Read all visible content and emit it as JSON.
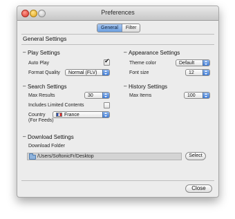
{
  "window": {
    "title": "Preferences"
  },
  "tabs": [
    {
      "label": "General",
      "active": true
    },
    {
      "label": "Filter",
      "active": false
    }
  ],
  "general_heading": "General Settings",
  "play": {
    "title": "Play Settings",
    "auto_play_label": "Auto Play",
    "auto_play_checked": true,
    "format_quality_label": "Format Quality",
    "format_quality_value": "Normal (FLV)"
  },
  "search": {
    "title": "Search Settings",
    "max_results_label": "Max Results",
    "max_results_value": "30",
    "limited_contents_label": "Includes Limited Contents",
    "limited_contents_checked": false,
    "country_label": "Country",
    "country_sublabel": "(For Feeds)",
    "country_value": "France"
  },
  "appearance": {
    "title": "Appearance Settings",
    "theme_color_label": "Theme color",
    "theme_color_value": "Default",
    "font_size_label": "Font size",
    "font_size_value": "12"
  },
  "history": {
    "title": "History Settings",
    "max_items_label": "Max Items",
    "max_items_value": "100"
  },
  "download": {
    "title": "Download Settings",
    "folder_label": "Download Folder",
    "folder_path": "/Users/SoftonicFr/Desktop",
    "select_label": "Select"
  },
  "close_label": "Close"
}
